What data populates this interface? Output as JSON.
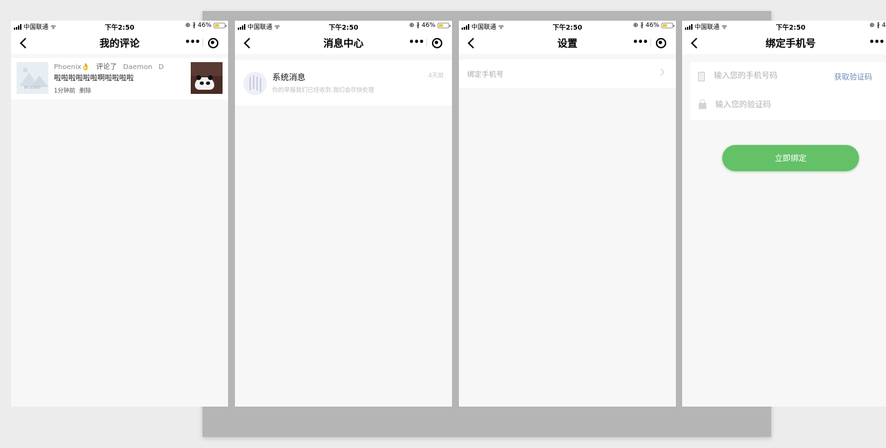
{
  "status_bar": {
    "carrier": "中国联通",
    "time": "下午2:50",
    "battery": "46%"
  },
  "capsule": {
    "more": "•••"
  },
  "screens": {
    "comments": {
      "title": "我的评论",
      "item": {
        "thumb_caption": "图片无法显示",
        "user": "Phoenix👌",
        "action": "评论了",
        "target": "Daemon",
        "target_suffix": "D",
        "text": "啦啦啦啦啦啦啊啦啦啦啦",
        "time": "1分钟前",
        "delete_label": "删除"
      }
    },
    "messages": {
      "title": "消息中心",
      "item": {
        "title": "系统消息",
        "subtitle": "你的举报我们已经收到,我们会尽快处理",
        "time": "4天前"
      }
    },
    "settings": {
      "title": "设置",
      "items": [
        {
          "label": "绑定手机号"
        }
      ]
    },
    "bind_phone": {
      "title": "绑定手机号",
      "phone_placeholder": "输入您的手机号码",
      "get_code_label": "获取验证码",
      "code_placeholder": "输入您的验证码",
      "submit_label": "立即绑定"
    }
  },
  "colors": {
    "accent_green": "#64c168",
    "link_blue": "#6f8fb5",
    "battery_yellow": "#f3c423",
    "backdrop_gray": "#b5b5b5"
  }
}
